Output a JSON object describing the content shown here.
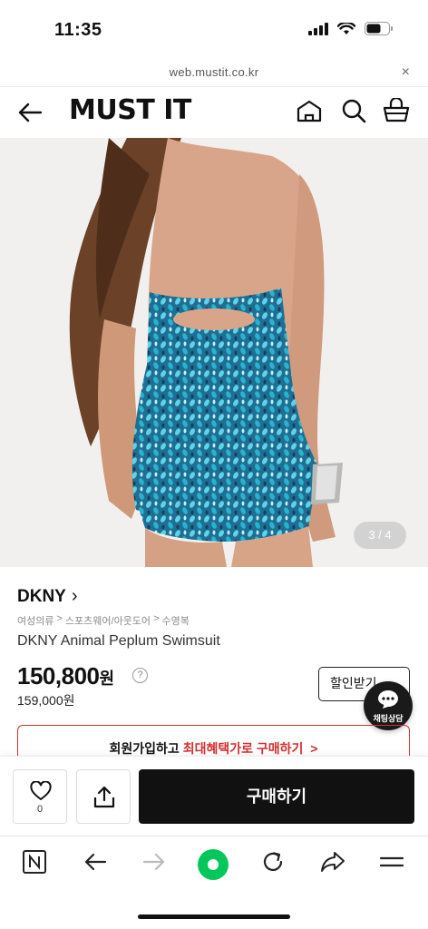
{
  "status_bar": {
    "time": "11:35"
  },
  "url_bar": {
    "url": "web.mustit.co.kr",
    "close_glyph": "×"
  },
  "header": {
    "logo": "MUST IT",
    "icons": [
      "back-arrow-icon",
      "home-icon",
      "search-icon",
      "cart-icon"
    ]
  },
  "hero": {
    "image_counter": "3 / 4",
    "image_subject": "back view of teal patterned strapless swimsuit"
  },
  "product": {
    "brand": "DKNY",
    "brand_chevron": "›",
    "breadcrumbs": [
      "여성의류",
      "스포츠웨어/아웃도어",
      "수영복"
    ],
    "crumb_sep": ">",
    "name": "DKNY Animal Peplum Swimsuit",
    "price": "150,800",
    "price_unit": "원",
    "price_help": "?",
    "original_price": "159,000원",
    "discount_button": "할인받기"
  },
  "chat": {
    "label": "채팅상담"
  },
  "banner": {
    "text_prefix": "회원가입하고 ",
    "text_highlight": "최대혜택가로 구매하기",
    "chevron": ">"
  },
  "buy_bar": {
    "like_count": "0",
    "buy_label": "구매하기"
  },
  "browser_toolbar": {
    "items": [
      "naver-icon",
      "back-icon",
      "forward-icon",
      "green-dot-home-icon",
      "refresh-icon",
      "share-icon",
      "menu-icon"
    ]
  },
  "colors": {
    "accent_red": "#d32f2f",
    "buy_black": "#111111",
    "green": "#03c75a",
    "swimsuit_teal": "#2a9fc0"
  }
}
